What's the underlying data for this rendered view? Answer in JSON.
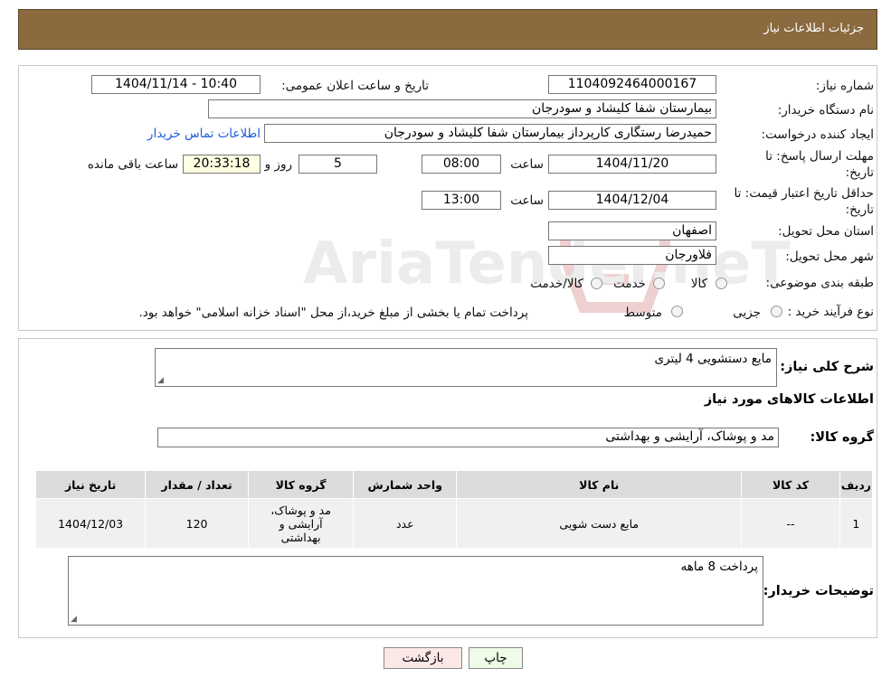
{
  "header": {
    "title": "جزئیات اطلاعات نیاز"
  },
  "fields": {
    "need_number_label": "شماره نیاز:",
    "need_number": "1104092464000167",
    "announce_label": "تاریخ و ساعت اعلان عمومی:",
    "announce_value": "1404/11/14 - 10:40",
    "buyer_org_label": "نام دستگاه خریدار:",
    "buyer_org": "بیمارستان شفا کلیشاد و سودرجان",
    "creator_label": "ایجاد کننده درخواست:",
    "creator": "حمیدرضا رستگاری کارپرداز بیمارستان شفا کلیشاد و سودرجان",
    "contact_link": "اطلاعات تماس خریدار",
    "deadline_label_1": "مهلت ارسال پاسخ: تا",
    "deadline_label_2": "تاریخ:",
    "deadline_date": "1404/11/20",
    "time_label": "ساعت",
    "deadline_time": "08:00",
    "days_count": "5",
    "days_label": "روز و",
    "remaining_time": "20:33:18",
    "remaining_label": "ساعت باقی مانده",
    "validity_label_1": "حداقل تاریخ اعتبار قیمت: تا",
    "validity_label_2": "تاریخ:",
    "validity_date": "1404/12/04",
    "validity_time": "13:00",
    "province_label": "استان محل تحویل:",
    "province": "اصفهان",
    "city_label": "شهر محل تحویل:",
    "city": "فلاورجان",
    "category_label": "طبقه بندی موضوعی:",
    "category_options": [
      "کالا",
      "خدمت",
      "کالا/خدمت"
    ],
    "process_label": "نوع فرآیند خرید :",
    "process_options": [
      "جزیی",
      "متوسط"
    ],
    "process_note": "پرداخت تمام یا بخشی از مبلغ خرید،از محل \"اسناد خزانه اسلامی\" خواهد بود."
  },
  "need": {
    "summary_label": "شرح کلی نیاز:",
    "summary": "مایع دستشویی 4 لیتری",
    "goods_info_title": "اطلاعات کالاهای مورد نیاز",
    "goods_group_label": "گروه کالا:",
    "goods_group": "مد و پوشاک، آرایشی و بهداشتی"
  },
  "table": {
    "headers": [
      "ردیف",
      "کد کالا",
      "نام کالا",
      "واحد شمارش",
      "گروه کالا",
      "تعداد / مقدار",
      "تاریخ نیاز"
    ],
    "rows": [
      [
        "1",
        "--",
        "مایع دست شویی",
        "عدد",
        "مد و پوشاک، آرایشی و بهداشتی",
        "120",
        "1404/12/03"
      ]
    ]
  },
  "notes": {
    "label": "توضیحات خریدار:",
    "text": "پرداخت 8 ماهه"
  },
  "buttons": {
    "print": "چاپ",
    "back": "بازگشت"
  },
  "watermark": {
    "text": "AriaTender.neT"
  }
}
